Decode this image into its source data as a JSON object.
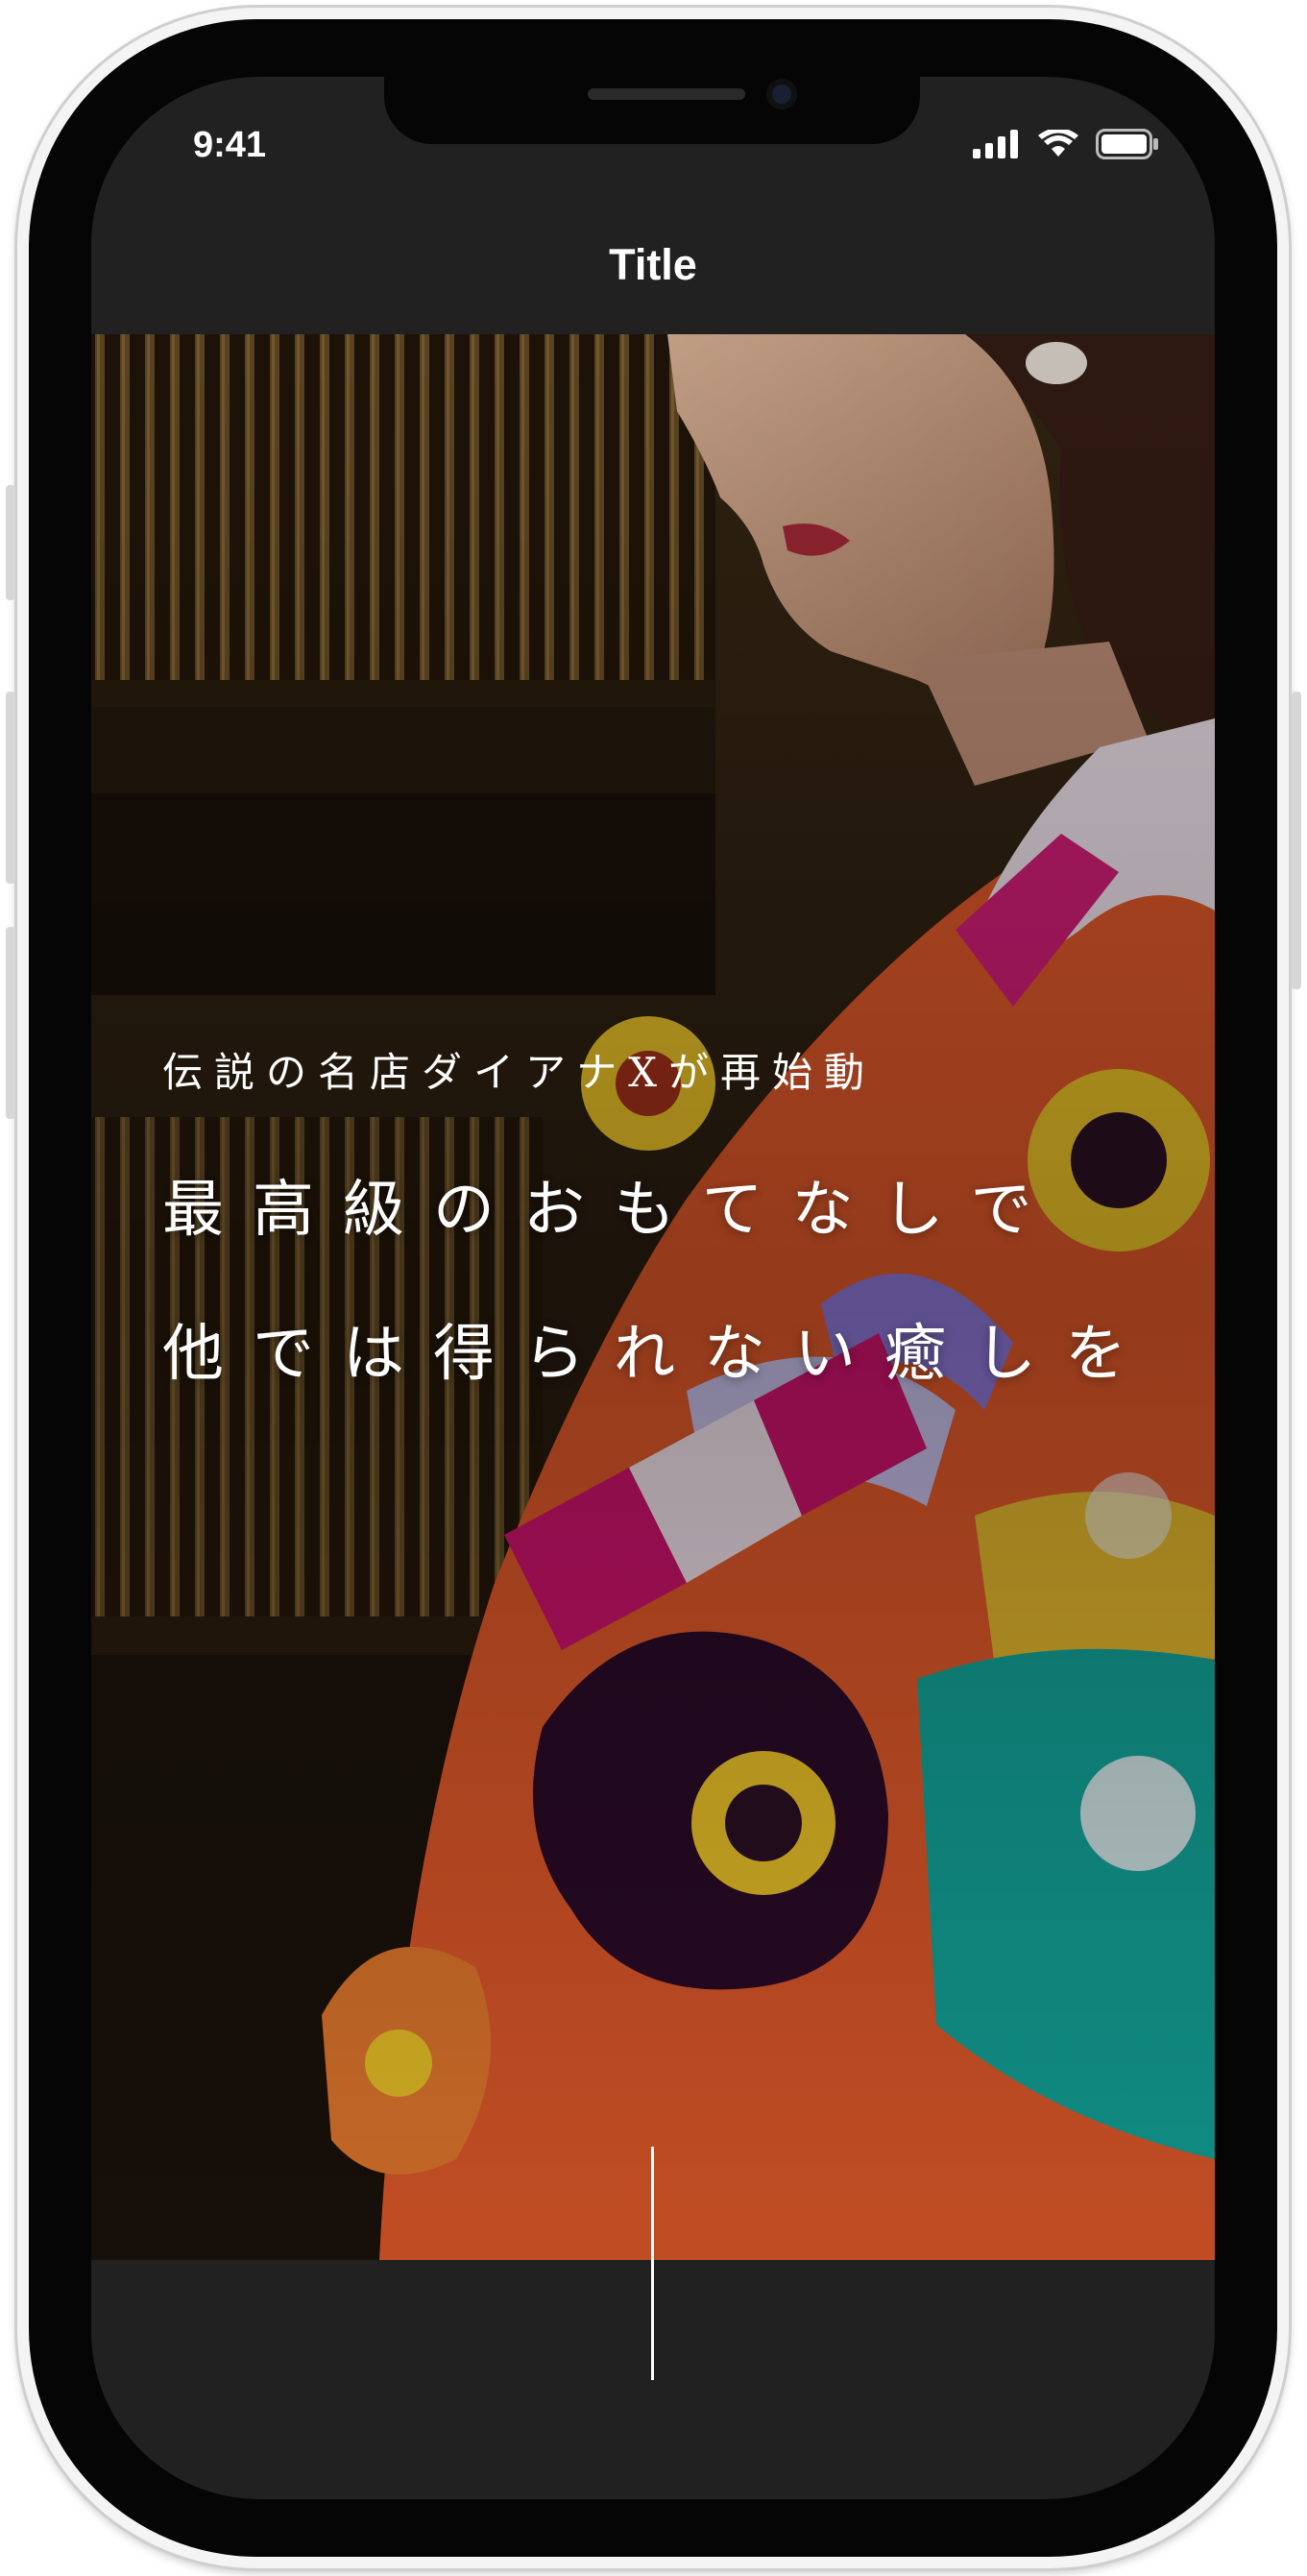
{
  "status_bar": {
    "time": "9:41"
  },
  "nav": {
    "title": "Title"
  },
  "hero": {
    "subtitle": "伝説の名店ダイアナXが再始動",
    "headline_line1": "最高級のおもてなしで",
    "headline_line2": "他では得られない癒しを"
  },
  "icons": [
    "signal-icon",
    "wifi-icon",
    "battery-icon"
  ],
  "colors": {
    "screen_bg": "#212121",
    "frame": "#050505",
    "text": "#ffffff"
  }
}
